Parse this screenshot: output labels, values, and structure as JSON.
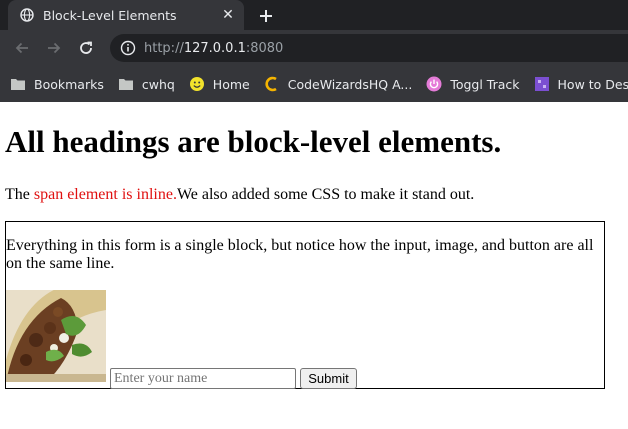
{
  "browser": {
    "tab": {
      "title": "Block-Level Elements"
    },
    "address": {
      "scheme": "http://",
      "host": "127.0.0.1",
      "port": ":8080"
    },
    "bookmarks": [
      {
        "label": "Bookmarks",
        "icon": "folder-icon"
      },
      {
        "label": "cwhq",
        "icon": "folder-icon"
      },
      {
        "label": "Home",
        "icon": "smiley-icon"
      },
      {
        "label": "CodeWizardsHQ A...",
        "icon": "codewizards-icon"
      },
      {
        "label": "Toggl Track",
        "icon": "power-icon"
      },
      {
        "label": "How to Design",
        "icon": "game-icon"
      }
    ],
    "colors": {
      "tabstrip": "#202124",
      "toolbar": "#35363a",
      "text": "#e8eaed"
    }
  },
  "page": {
    "heading": "All headings are block-level elements.",
    "para": {
      "before": "The ",
      "span": "span element is inline.",
      "after": "We also added some CSS to make it stand out."
    },
    "form": {
      "text": "Everything in this form is a single block, but notice how the input, image, and button are all on the same line.",
      "input_placeholder": "Enter your name",
      "submit_label": "Submit"
    },
    "colors": {
      "span": "#e01010"
    }
  }
}
